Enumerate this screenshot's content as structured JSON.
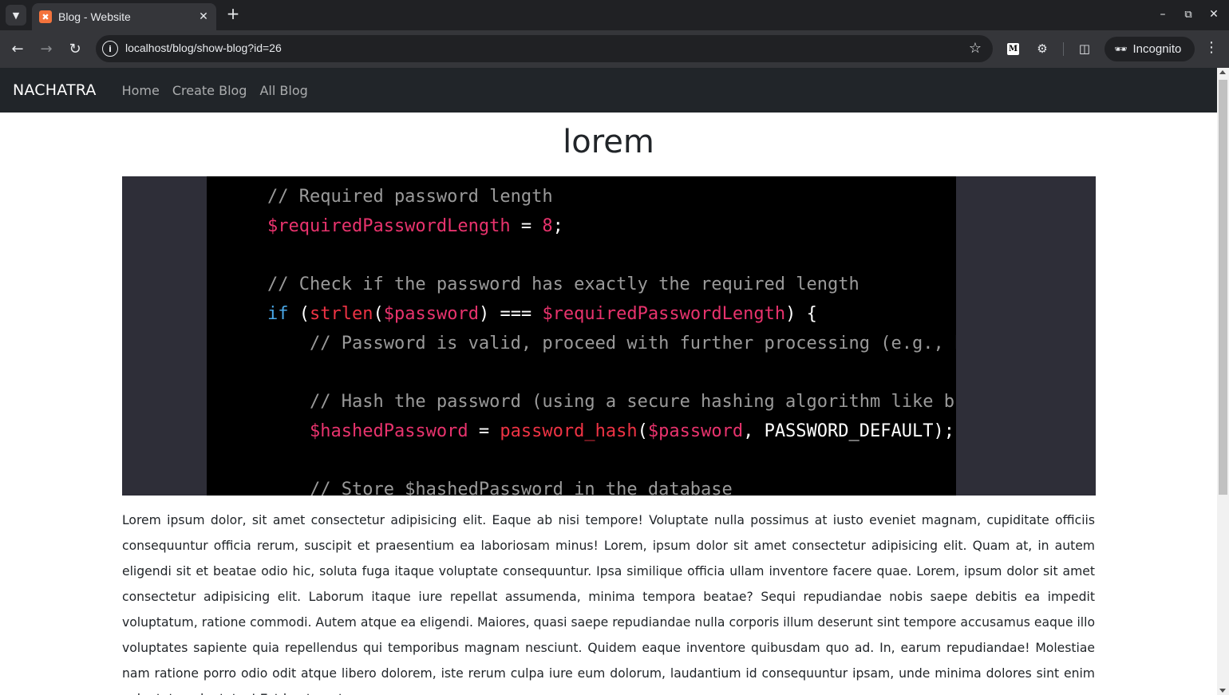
{
  "browser": {
    "tab_title": "Blog - Website",
    "url": "localhost/blog/show-blog?id=26",
    "incognito_label": "Incognito",
    "extension_label": "M"
  },
  "site": {
    "brand": "NACHATRA",
    "nav": [
      "Home",
      "Create Blog",
      "All Blog"
    ]
  },
  "post": {
    "title": "lorem",
    "image_code": [
      {
        "indent": "",
        "parts": [
          {
            "t": "// Required password length",
            "k": "comment"
          }
        ]
      },
      {
        "indent": "",
        "parts": [
          {
            "t": "$requiredPasswordLength",
            "k": "var"
          },
          {
            "t": " = ",
            "k": "plain"
          },
          {
            "t": "8",
            "k": "num"
          },
          {
            "t": ";",
            "k": "plain"
          }
        ]
      },
      {
        "indent": "",
        "parts": []
      },
      {
        "indent": "",
        "parts": [
          {
            "t": "// Check if the password has exactly the required length",
            "k": "comment"
          }
        ]
      },
      {
        "indent": "",
        "parts": [
          {
            "t": "if",
            "k": "kw"
          },
          {
            "t": " (",
            "k": "plain"
          },
          {
            "t": "strlen",
            "k": "fn"
          },
          {
            "t": "(",
            "k": "plain"
          },
          {
            "t": "$password",
            "k": "var"
          },
          {
            "t": ") === ",
            "k": "plain"
          },
          {
            "t": "$requiredPasswordLength",
            "k": "var"
          },
          {
            "t": ") {",
            "k": "plain"
          }
        ]
      },
      {
        "indent": "    ",
        "parts": [
          {
            "t": "// Password is valid, proceed with further processing (e.g., ha",
            "k": "comment"
          }
        ]
      },
      {
        "indent": "",
        "parts": []
      },
      {
        "indent": "    ",
        "parts": [
          {
            "t": "// Hash the password (using a secure hashing algorithm like bcr",
            "k": "comment"
          }
        ]
      },
      {
        "indent": "    ",
        "parts": [
          {
            "t": "$hashedPassword",
            "k": "var"
          },
          {
            "t": " = ",
            "k": "plain"
          },
          {
            "t": "password_hash",
            "k": "fn"
          },
          {
            "t": "(",
            "k": "plain"
          },
          {
            "t": "$password",
            "k": "var"
          },
          {
            "t": ", PASSWORD_DEFAULT);",
            "k": "plain"
          }
        ]
      },
      {
        "indent": "",
        "parts": []
      },
      {
        "indent": "    ",
        "parts": [
          {
            "t": "// Store $hashedPassword in the database",
            "k": "comment"
          }
        ]
      }
    ],
    "body": "Lorem ipsum dolor, sit amet consectetur adipisicing elit. Eaque ab nisi tempore! Voluptate nulla possimus at iusto eveniet magnam, cupiditate officiis consequuntur officia rerum, suscipit et praesentium ea laboriosam minus! Lorem, ipsum dolor sit amet consectetur adipisicing elit. Quam at, in autem eligendi sit et beatae odio hic, soluta fuga itaque voluptate consequuntur. Ipsa similique officia ullam inventore facere quae. Lorem, ipsum dolor sit amet consectetur adipisicing elit. Laborum itaque iure repellat assumenda, minima tempora beatae? Sequi repudiandae nobis saepe debitis ea impedit voluptatum, ratione commodi. Autem atque ea eligendi. Maiores, quasi saepe repudiandae nulla corporis illum deserunt sint tempore accusamus eaque illo voluptates sapiente quia repellendus qui temporibus magnam nesciunt. Quidem eaque inventore quibusdam quo ad. In, earum repudiandae! Molestiae nam ratione porro odio odit atque libero dolorem, iste rerum culpa iure eum dolorum, laudantium id consequuntur ipsam, unde minima dolores sint enim voluptate voluptates! Est beatae ut"
  }
}
